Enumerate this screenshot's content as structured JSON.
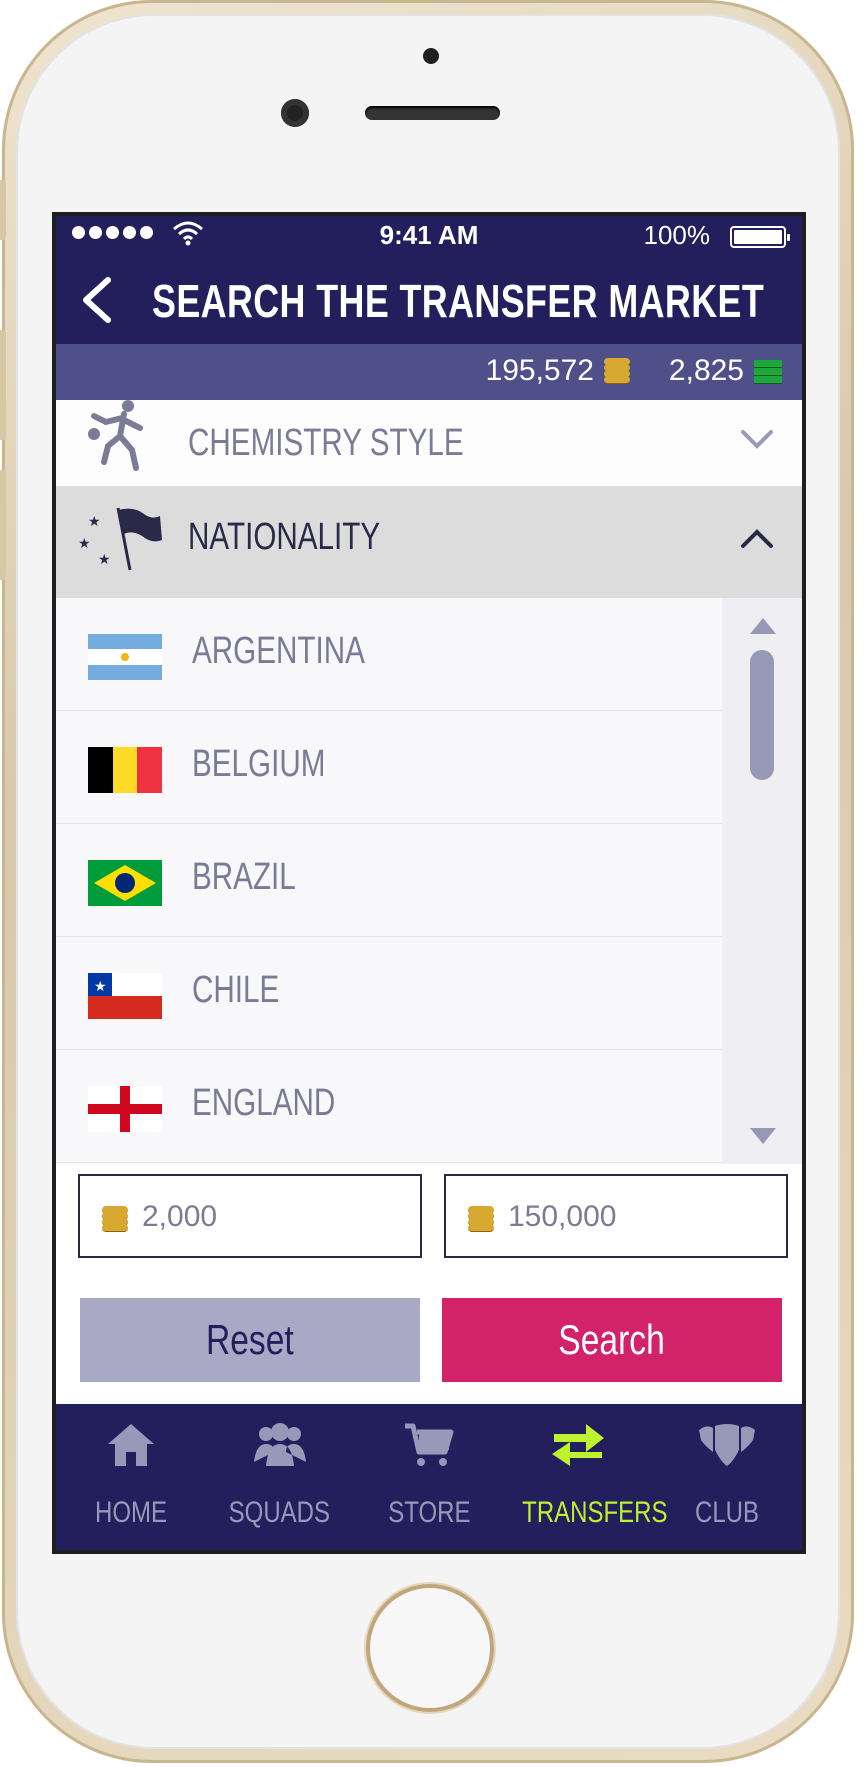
{
  "status_bar": {
    "time": "9:41 AM",
    "battery": "100%"
  },
  "header": {
    "title": "SEARCH THE TRANSFER MARKET"
  },
  "currency": {
    "coins": "195,572",
    "points": "2,825"
  },
  "filters": {
    "chemistry_style": {
      "label": "CHEMISTRY STYLE",
      "icon": "player-kick-icon",
      "chevron": "chevron-down-icon"
    },
    "nationality": {
      "label": "NATIONALITY",
      "icon": "flag-stars-icon",
      "chevron": "chevron-up-icon"
    }
  },
  "nations": [
    {
      "label": "ARGENTINA",
      "flag": "argentina-flag-icon"
    },
    {
      "label": "BELGIUM",
      "flag": "belgium-flag-icon"
    },
    {
      "label": "BRAZIL",
      "flag": "brazil-flag-icon"
    },
    {
      "label": "CHILE",
      "flag": "chile-flag-icon"
    },
    {
      "label": "ENGLAND",
      "flag": "england-flag-icon"
    }
  ],
  "price": {
    "min": "2,000",
    "max": "150,000"
  },
  "buttons": {
    "reset": "Reset",
    "search": "Search"
  },
  "tabs": [
    {
      "label": "HOME",
      "icon": "home-icon"
    },
    {
      "label": "SQUADS",
      "icon": "squads-icon"
    },
    {
      "label": "STORE",
      "icon": "cart-icon"
    },
    {
      "label": "TRANSFERS",
      "icon": "transfers-icon",
      "active": true
    },
    {
      "label": "CLUB",
      "icon": "club-shield-icon"
    }
  ],
  "colors": {
    "navy": "#221f5c",
    "coin_bar": "#4f4f89",
    "search_accent": "#d2226a",
    "active_tab": "#bdf230",
    "reset_button": "#a9a9c6"
  }
}
